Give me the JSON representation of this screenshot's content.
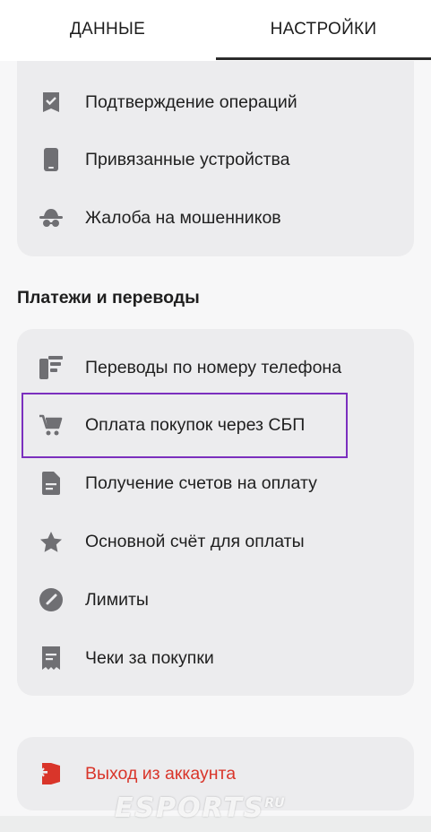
{
  "tabs": [
    {
      "label": "ДАННЫЕ",
      "active": false
    },
    {
      "label": "НАСТРОЙКИ",
      "active": true
    }
  ],
  "security_items": [
    {
      "label": "Подтверждение операций",
      "icon": "confirm-icon"
    },
    {
      "label": "Привязанные устройства",
      "icon": "phone-icon"
    },
    {
      "label": "Жалоба на мошенников",
      "icon": "spy-icon"
    }
  ],
  "payments": {
    "title": "Платежи и переводы",
    "items": [
      {
        "label": "Переводы по номеру телефона",
        "icon": "phone-transfer-icon"
      },
      {
        "label": "Оплата покупок через СБП",
        "icon": "cart-icon",
        "highlighted": true
      },
      {
        "label": "Получение счетов на оплату",
        "icon": "document-icon"
      },
      {
        "label": "Основной счёт для оплаты",
        "icon": "star-icon"
      },
      {
        "label": "Лимиты",
        "icon": "gauge-icon"
      },
      {
        "label": "Чеки за покупки",
        "icon": "receipt-icon"
      }
    ]
  },
  "logout": {
    "label": "Выход из аккаунта",
    "icon": "logout-icon",
    "color": "#d9352a"
  },
  "watermark": {
    "text": "ESPORTS",
    "suffix": "RU"
  },
  "colors": {
    "icon_gray": "#6f6f73",
    "highlight": "#7b2fbe",
    "card": "#ececee"
  }
}
